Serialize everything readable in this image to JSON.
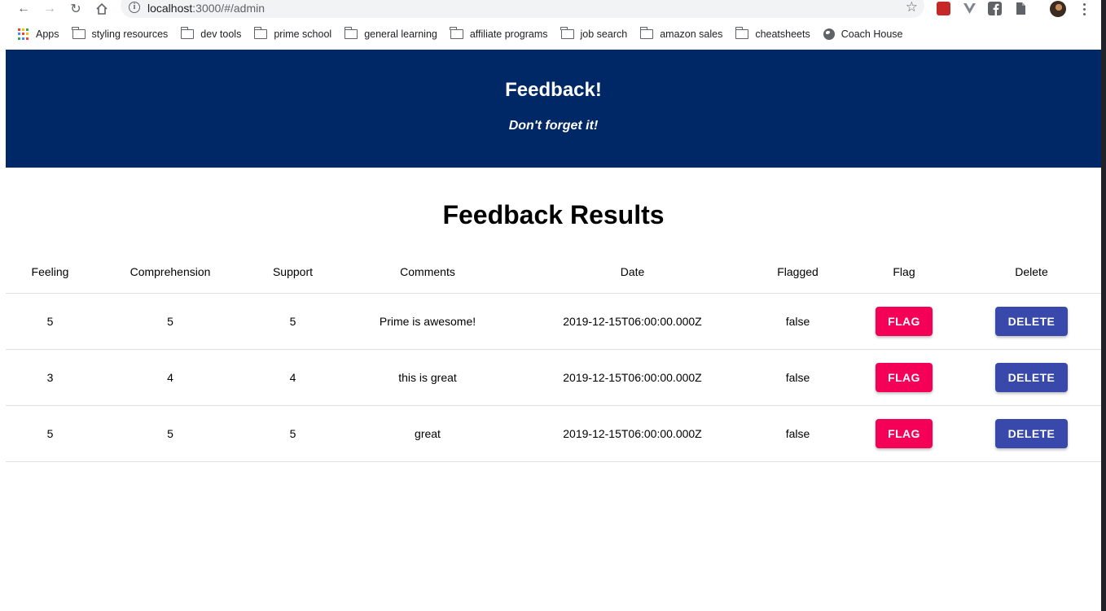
{
  "browser": {
    "url_host": "localhost",
    "url_rest": ":3000/#/admin",
    "bookmarks": [
      {
        "label": "Apps",
        "icon": "apps-grid-icon"
      },
      {
        "label": "styling resources",
        "icon": "folder-icon"
      },
      {
        "label": "dev tools",
        "icon": "folder-icon"
      },
      {
        "label": "prime school",
        "icon": "folder-icon"
      },
      {
        "label": "general learning",
        "icon": "folder-icon"
      },
      {
        "label": "affiliate programs",
        "icon": "folder-icon"
      },
      {
        "label": "job search",
        "icon": "folder-icon"
      },
      {
        "label": "amazon sales",
        "icon": "folder-icon"
      },
      {
        "label": "cheatsheets",
        "icon": "folder-icon"
      },
      {
        "label": "Coach House",
        "icon": "globe-icon"
      }
    ]
  },
  "header": {
    "title": "Feedback!",
    "subtitle": "Don't forget it!"
  },
  "results": {
    "title": "Feedback Results",
    "columns": [
      "Feeling",
      "Comprehension",
      "Support",
      "Comments",
      "Date",
      "Flagged",
      "Flag",
      "Delete"
    ],
    "rows": [
      {
        "feeling": "5",
        "comprehension": "5",
        "support": "5",
        "comments": "Prime is awesome!",
        "date": "2019-12-15T06:00:00.000Z",
        "flagged": "false"
      },
      {
        "feeling": "3",
        "comprehension": "4",
        "support": "4",
        "comments": "this is great",
        "date": "2019-12-15T06:00:00.000Z",
        "flagged": "false"
      },
      {
        "feeling": "5",
        "comprehension": "5",
        "support": "5",
        "comments": "great",
        "date": "2019-12-15T06:00:00.000Z",
        "flagged": "false"
      }
    ],
    "flag_label": "FLAG",
    "delete_label": "DELETE"
  },
  "colors": {
    "header_bg": "#002866",
    "flag_button": "#f50057",
    "delete_button": "#3949ab"
  }
}
